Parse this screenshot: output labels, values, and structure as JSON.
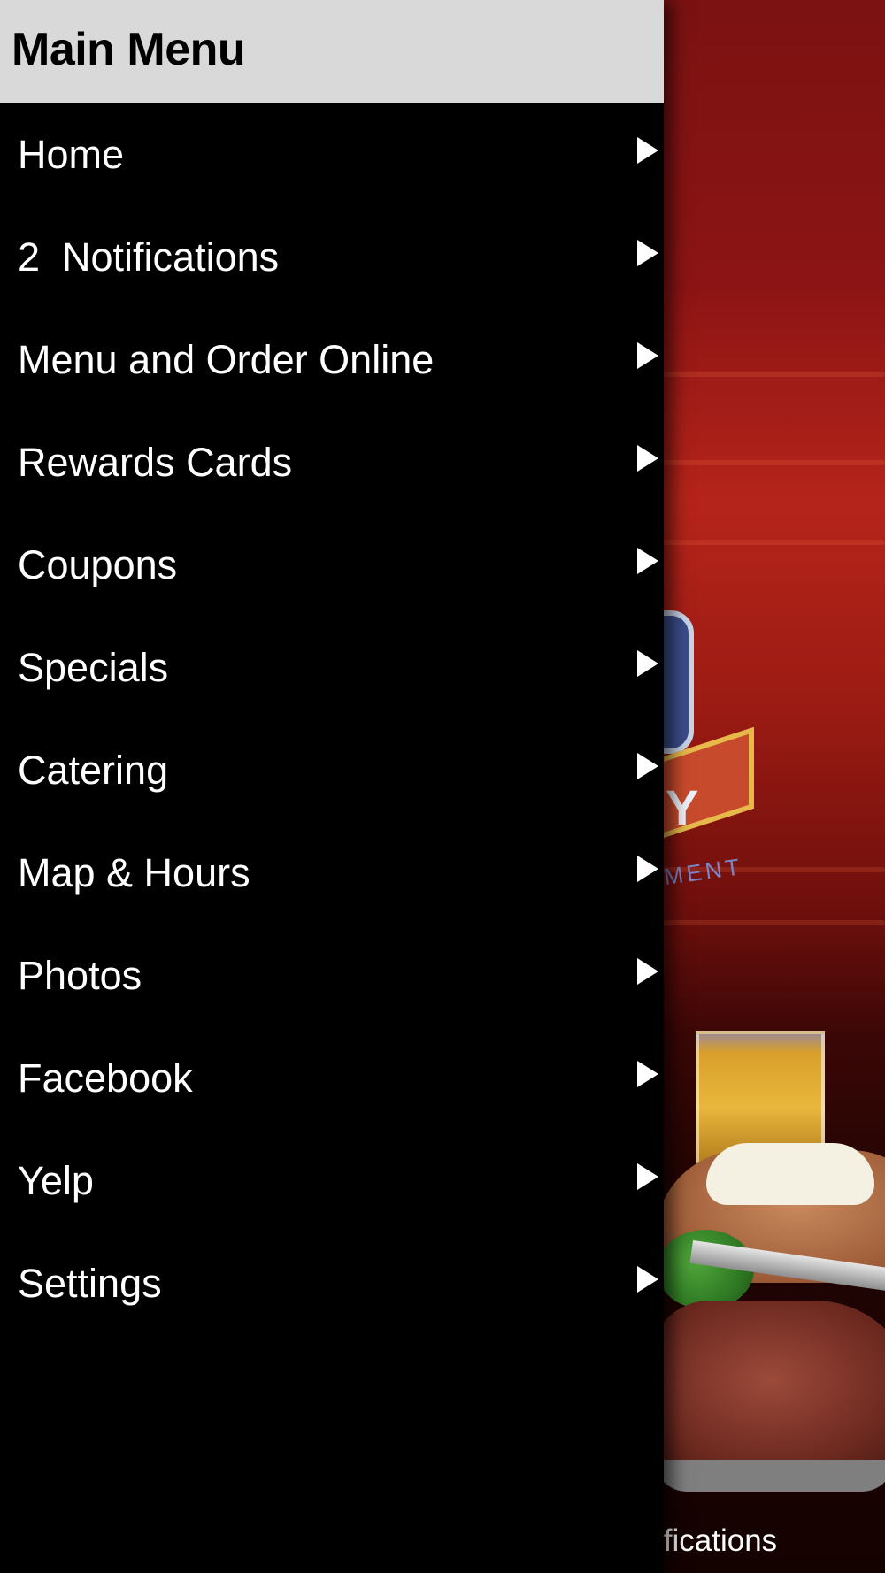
{
  "drawer": {
    "title": "Main Menu",
    "items": [
      {
        "label": "Home",
        "icon": "chevron-right-icon"
      },
      {
        "label": "2  Notifications",
        "icon": "chevron-right-icon"
      },
      {
        "label": "Menu and Order Online",
        "icon": "chevron-right-icon"
      },
      {
        "label": "Rewards Cards",
        "icon": "chevron-right-icon"
      },
      {
        "label": "Coupons",
        "icon": "chevron-right-icon"
      },
      {
        "label": "Specials",
        "icon": "chevron-right-icon"
      },
      {
        "label": "Catering",
        "icon": "chevron-right-icon"
      },
      {
        "label": "Map & Hours",
        "icon": "chevron-right-icon"
      },
      {
        "label": "Photos",
        "icon": "chevron-right-icon"
      },
      {
        "label": "Facebook",
        "icon": "chevron-right-icon"
      },
      {
        "label": "Yelp",
        "icon": "chevron-right-icon"
      },
      {
        "label": "Settings",
        "icon": "chevron-right-icon"
      }
    ]
  },
  "background": {
    "bottom_label": "ifications",
    "emblem_letter": "Y",
    "emblem_text": "MENT"
  },
  "colors": {
    "header_bg": "#d9d9d9",
    "drawer_bg": "#000000",
    "item_text": "#ffffff",
    "title_text": "#000000"
  }
}
